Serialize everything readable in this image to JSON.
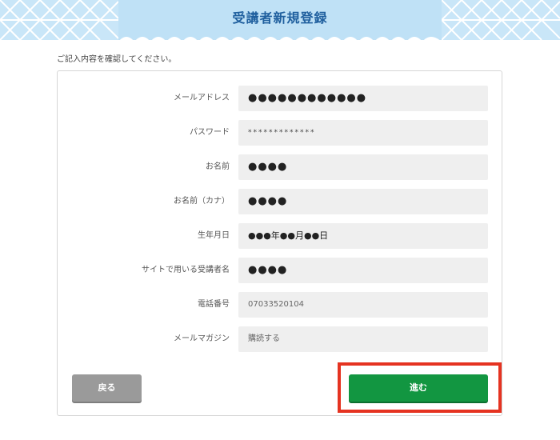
{
  "header": {
    "title": "受講者新規登録"
  },
  "instruction": "ご記入内容を確認してください。",
  "form": {
    "rows": [
      {
        "label": "メールアドレス",
        "value": "●●●●●●●●●●●●"
      },
      {
        "label": "パスワード",
        "value": "*************"
      },
      {
        "label": "お名前",
        "value": "●●●●"
      },
      {
        "label": "お名前（カナ）",
        "value": "●●●●"
      },
      {
        "label": "生年月日",
        "value": "●●●年●●月●●日"
      },
      {
        "label": "サイトで用いる受講者名",
        "value": "●●●●"
      },
      {
        "label": "電話番号",
        "value": "07033520104"
      },
      {
        "label": "メールマガジン",
        "value": "購読する"
      }
    ]
  },
  "buttons": {
    "back_label": "戻る",
    "next_label": "進む"
  },
  "colors": {
    "header_bg": "#bfe1f6",
    "title": "#1f5f9e",
    "next_button": "#129641",
    "back_button": "#9a9a9a",
    "highlight": "#e53321"
  }
}
